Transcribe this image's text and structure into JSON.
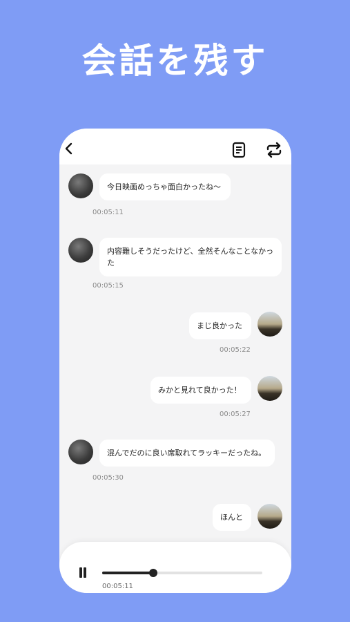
{
  "headline": "会話を残す",
  "colors": {
    "background": "#7f9cf5",
    "bubble": "#ffffff",
    "chat_bg": "#f4f4f5"
  },
  "icons": {
    "back": "chevron-left-icon",
    "transcript": "document-icon",
    "repeat": "repeat-icon",
    "pause": "pause-icon"
  },
  "messages": [
    {
      "side": "left",
      "text": "今日映画めっちゃ面白かったね〜",
      "time": "00:05:11"
    },
    {
      "side": "left",
      "text": "内容難しそうだったけど、全然そんなことなかった",
      "time": "00:05:15"
    },
    {
      "side": "right",
      "text": "まじ良かった",
      "time": "00:05:22"
    },
    {
      "side": "right",
      "text": "みかと見れて良かった！",
      "time": "00:05:27"
    },
    {
      "side": "left",
      "text": "混んでだのに良い席取れてラッキーだったね。",
      "time": "00:05:30"
    },
    {
      "side": "right",
      "text": "ほんと",
      "time": ""
    }
  ],
  "player": {
    "current_time": "00:05:11",
    "progress": 0.32
  }
}
